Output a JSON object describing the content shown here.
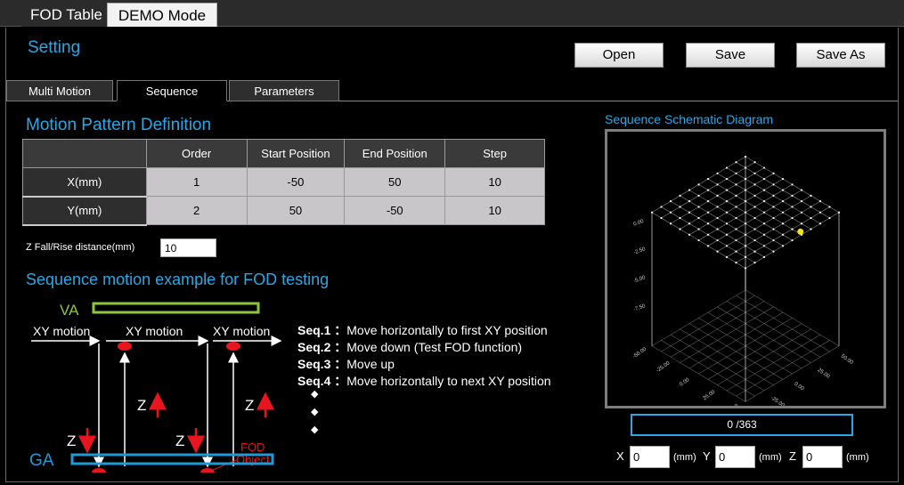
{
  "top_tabs": [
    {
      "label": "FOD Table"
    },
    {
      "label": "DEMO Mode"
    }
  ],
  "setting": {
    "title": "Setting",
    "open_label": "Open",
    "save_label": "Save",
    "save_as_label": "Save As"
  },
  "sub_tabs": [
    {
      "label": "Multi Motion"
    },
    {
      "label": "Sequence"
    },
    {
      "label": "Parameters"
    }
  ],
  "motion_pattern": {
    "title": "Motion Pattern Definition",
    "headers": [
      "",
      "Order",
      "Start Position",
      "End Position",
      "Step"
    ],
    "rows": [
      {
        "label": "X(mm)",
        "order": "1",
        "start": "-50",
        "end": "50",
        "step": "10"
      },
      {
        "label": "Y(mm)",
        "order": "2",
        "start": "50",
        "end": "-50",
        "step": "10"
      }
    ],
    "z_fall_label": "Z Fall/Rise distance(mm)",
    "z_fall_value": "10"
  },
  "sequence_example": {
    "title": "Sequence motion example for FOD testing",
    "va_label": "VA",
    "ga_label": "GA",
    "xy_motion_label": "XY motion",
    "z_label": "Z",
    "fod_object_label_1": "FOD",
    "fod_object_label_2": "Object",
    "steps": [
      {
        "key": "Seq.1",
        "sep": "：",
        "text": "Move horizontally to first XY position"
      },
      {
        "key": "Seq.2",
        "sep": "：",
        "text": "Move down (Test FOD function)"
      },
      {
        "key": "Seq.3",
        "sep": "：",
        "text": "Move up"
      },
      {
        "key": "Seq.4",
        "sep": "：",
        "text": "Move horizontally to next XY position"
      }
    ],
    "bullet": "◆"
  },
  "schematic": {
    "title": "Sequence Schematic Diagram",
    "z_ticks": [
      "0.00",
      "-2.50",
      "-5.00",
      "-7.50"
    ],
    "x_ticks": [
      "-50.00",
      "-25.00",
      "0.00",
      "25.00",
      "50.00"
    ],
    "y_ticks": [
      "-50.00",
      "-25.00",
      "0.00",
      "25.00",
      "50.00"
    ]
  },
  "progress": {
    "text": "0 /363",
    "current": 0,
    "total": 363
  },
  "position": {
    "x_label": "X",
    "x_value": "0",
    "y_label": "Y",
    "y_value": "0",
    "z_label": "Z",
    "z_value": "0",
    "unit": "(mm)"
  },
  "colors": {
    "accent": "#2aa7e6",
    "red": "#e8141e",
    "va_green": "#8cc63f",
    "ga_blue": "#1e9ad6"
  }
}
